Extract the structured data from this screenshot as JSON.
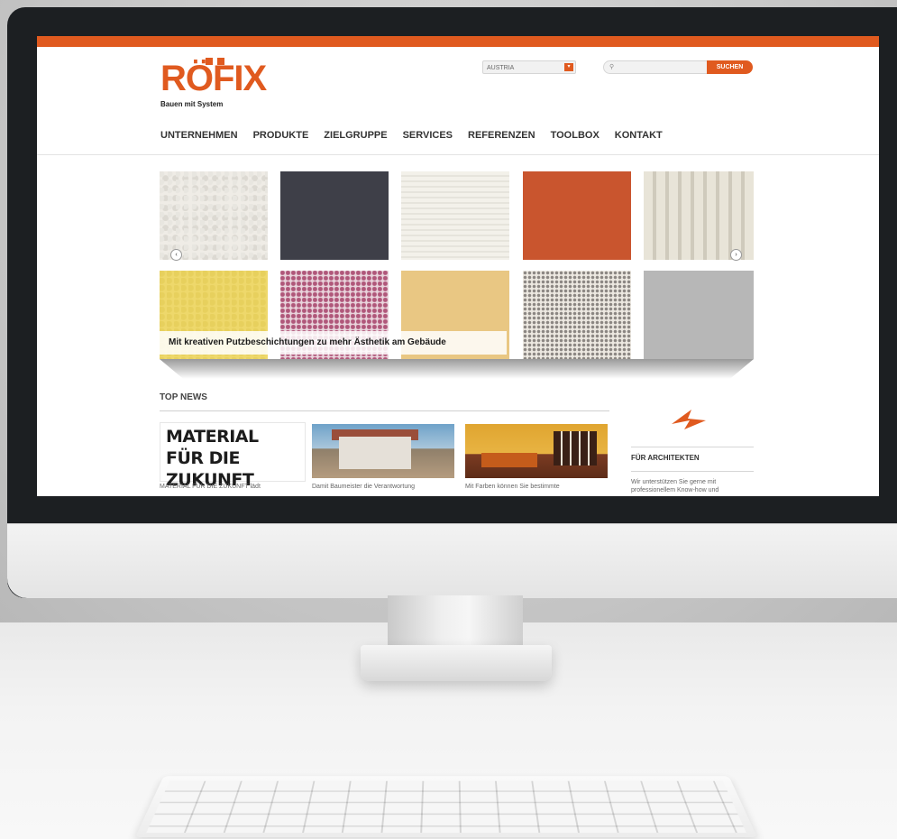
{
  "brand": {
    "logo_text": "RÖFIX",
    "tagline": "Bauen mit System",
    "accent_color": "#e05a1f"
  },
  "header": {
    "country_select": {
      "value": "AUSTRIA",
      "button_icon": "chevron-down-icon"
    },
    "search": {
      "icon": "search-icon",
      "button_label": "SUCHEN"
    }
  },
  "nav": {
    "items": [
      "UNTERNEHMEN",
      "PRODUKTE",
      "ZIELGRUPPE",
      "SERVICES",
      "REFERENZEN",
      "TOOLBOX",
      "KONTAKT"
    ]
  },
  "slider": {
    "caption": "Mit kreativen Putzbeschichtungen zu mehr Ästhetik am Gebäude",
    "prev_icon": "chevron-left-icon",
    "next_icon": "chevron-right-icon"
  },
  "news": {
    "section_title": "TOP NEWS",
    "headline": "MATERIAL FÜR DIE ZUKUNFT",
    "items": [
      {
        "snippet": "MATERIAL FÜR DIE ZUKUNFT lädt"
      },
      {
        "snippet": "Damit Baumeister die Verantwortung"
      },
      {
        "snippet": "Mit Farben können Sie bestimmte"
      }
    ]
  },
  "sidebar": {
    "icon": "architect-logo-icon",
    "title": "FÜR ARCHITEKTEN",
    "text": "Wir unterstützen Sie gerne mit professionellem Know-how und"
  }
}
